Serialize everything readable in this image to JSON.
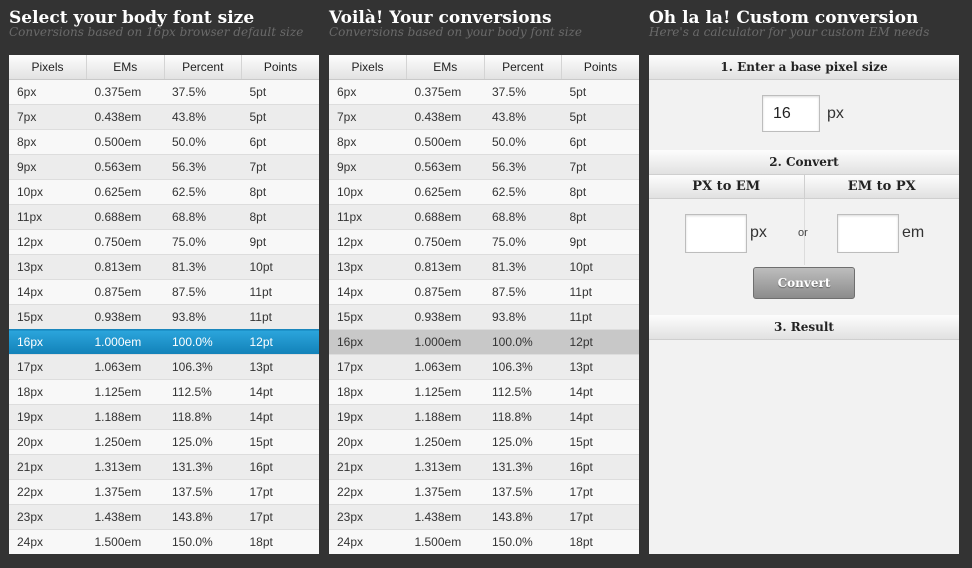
{
  "panel1": {
    "title": "Select your body font size",
    "subtitle": "Conversions based on 16px browser default size"
  },
  "panel2": {
    "title": "Voilà! Your conversions",
    "subtitle": "Conversions based on your body font size"
  },
  "panel3": {
    "title": "Oh la la! Custom conversion",
    "subtitle": "Here's a calculator for your custom EM needs",
    "step1": "1. Enter a base pixel size",
    "base_value": "16",
    "base_unit": "px",
    "step2": "2. Convert",
    "px_to_em": "PX to EM",
    "em_to_px": "EM to PX",
    "px_unit": "px",
    "or_label": "or",
    "em_unit": "em",
    "convert_button": "Convert",
    "step3": "3. Result"
  },
  "table_headers": [
    "Pixels",
    "EMs",
    "Percent",
    "Points"
  ],
  "selected_pixels": "16px",
  "rows": [
    [
      "6px",
      "0.375em",
      "37.5%",
      "5pt"
    ],
    [
      "7px",
      "0.438em",
      "43.8%",
      "5pt"
    ],
    [
      "8px",
      "0.500em",
      "50.0%",
      "6pt"
    ],
    [
      "9px",
      "0.563em",
      "56.3%",
      "7pt"
    ],
    [
      "10px",
      "0.625em",
      "62.5%",
      "8pt"
    ],
    [
      "11px",
      "0.688em",
      "68.8%",
      "8pt"
    ],
    [
      "12px",
      "0.750em",
      "75.0%",
      "9pt"
    ],
    [
      "13px",
      "0.813em",
      "81.3%",
      "10pt"
    ],
    [
      "14px",
      "0.875em",
      "87.5%",
      "11pt"
    ],
    [
      "15px",
      "0.938em",
      "93.8%",
      "11pt"
    ],
    [
      "16px",
      "1.000em",
      "100.0%",
      "12pt"
    ],
    [
      "17px",
      "1.063em",
      "106.3%",
      "13pt"
    ],
    [
      "18px",
      "1.125em",
      "112.5%",
      "14pt"
    ],
    [
      "19px",
      "1.188em",
      "118.8%",
      "14pt"
    ],
    [
      "20px",
      "1.250em",
      "125.0%",
      "15pt"
    ],
    [
      "21px",
      "1.313em",
      "131.3%",
      "16pt"
    ],
    [
      "22px",
      "1.375em",
      "137.5%",
      "17pt"
    ],
    [
      "23px",
      "1.438em",
      "143.8%",
      "17pt"
    ],
    [
      "24px",
      "1.500em",
      "150.0%",
      "18pt"
    ]
  ]
}
